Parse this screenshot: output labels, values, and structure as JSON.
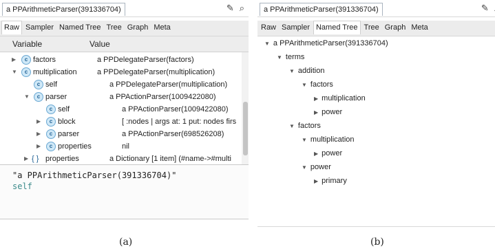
{
  "panel_a": {
    "title": "a PPArithmeticParser(391336704)",
    "tabs": [
      "Raw",
      "Sampler",
      "Named Tree",
      "Tree",
      "Graph",
      "Meta"
    ],
    "active_tab": "Raw",
    "columns": {
      "variable": "Variable",
      "value": "Value"
    },
    "rows": [
      {
        "name": "factors",
        "value": "a PPDelegateParser(factors)",
        "icon": "class-c-icon",
        "expand": "collapsed"
      },
      {
        "name": "multiplication",
        "value": "a PPDelegateParser(multiplication)",
        "icon": "class-c-icon",
        "expand": "expanded"
      },
      {
        "name": "self",
        "value": "a PPDelegateParser(multiplication)",
        "icon": "class-c-icon",
        "expand": "none"
      },
      {
        "name": "parser",
        "value": "a PPActionParser(1009422080)",
        "icon": "class-c-icon",
        "expand": "expanded"
      },
      {
        "name": "self",
        "value": "a PPActionParser(1009422080)",
        "icon": "class-c-icon",
        "expand": "none"
      },
      {
        "name": "block",
        "value": "[ :nodes |  args at: 1 put: nodes firs",
        "icon": "class-c-icon",
        "expand": "collapsed"
      },
      {
        "name": "parser",
        "value": "a PPActionParser(698526208)",
        "icon": "class-c-icon",
        "expand": "collapsed"
      },
      {
        "name": "properties",
        "value": "nil",
        "icon": "class-c-icon",
        "expand": "collapsed"
      },
      {
        "name": "properties",
        "value": "a Dictionary [1 item] (#name->#multi",
        "icon": "braces-icon",
        "expand": "collapsed"
      }
    ],
    "code": {
      "line1": "\"a PPArithmeticParser(391336704)\"",
      "line2": "self"
    }
  },
  "panel_b": {
    "title": "a PPArithmeticParser(391336704)",
    "tabs": [
      "Raw",
      "Sampler",
      "Named Tree",
      "Tree",
      "Graph",
      "Meta"
    ],
    "active_tab": "Named Tree",
    "tree": [
      {
        "label": "a PPArithmeticParser(391336704)",
        "expand": "expanded"
      },
      {
        "label": "terms",
        "expand": "expanded"
      },
      {
        "label": "addition",
        "expand": "expanded"
      },
      {
        "label": "factors",
        "expand": "expanded"
      },
      {
        "label": "multiplication",
        "expand": "collapsed"
      },
      {
        "label": "power",
        "expand": "collapsed"
      },
      {
        "label": "factors",
        "expand": "expanded"
      },
      {
        "label": "multiplication",
        "expand": "expanded"
      },
      {
        "label": "power",
        "expand": "collapsed"
      },
      {
        "label": "power",
        "expand": "expanded"
      },
      {
        "label": "primary",
        "expand": "collapsed"
      }
    ]
  },
  "captions": {
    "a": "(a)",
    "b": "(b)"
  },
  "icons": {
    "edit": "pencil-icon",
    "search": "magnifier-icon"
  }
}
